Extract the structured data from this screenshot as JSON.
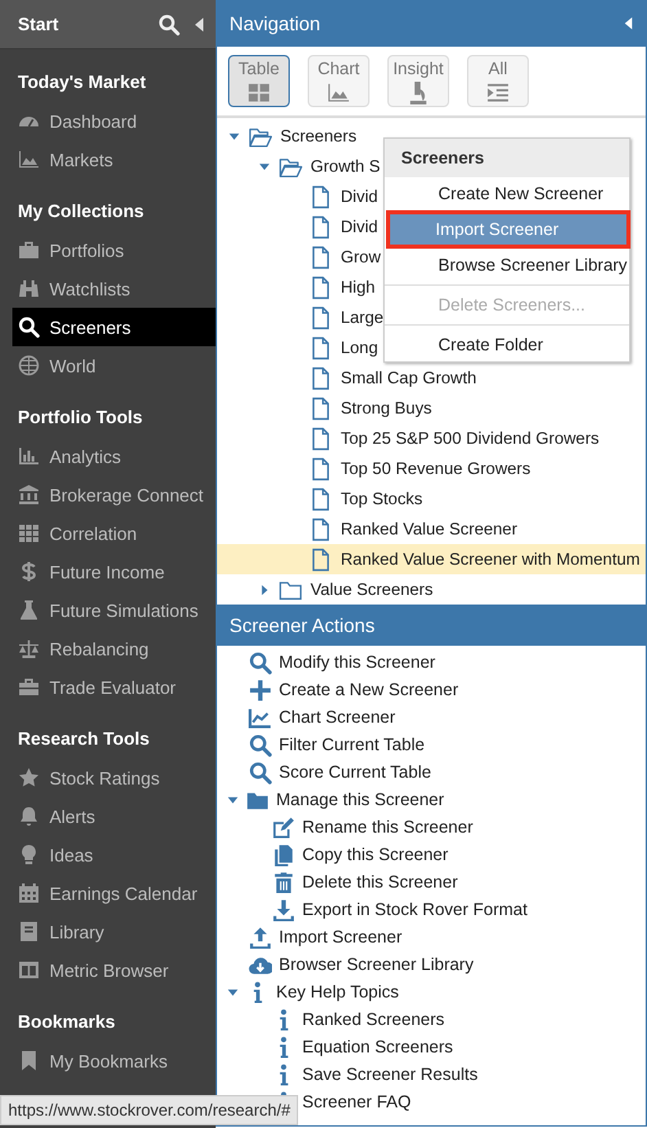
{
  "sidebar": {
    "title": "Start",
    "sections": [
      {
        "heading": "Today's Market",
        "items": [
          {
            "label": "Dashboard",
            "selected": false
          },
          {
            "label": "Markets",
            "selected": false
          }
        ]
      },
      {
        "heading": "My Collections",
        "items": [
          {
            "label": "Portfolios",
            "selected": false
          },
          {
            "label": "Watchlists",
            "selected": false
          },
          {
            "label": "Screeners",
            "selected": true
          },
          {
            "label": "World",
            "selected": false
          }
        ]
      },
      {
        "heading": "Portfolio Tools",
        "items": [
          {
            "label": "Analytics",
            "selected": false
          },
          {
            "label": "Brokerage Connect",
            "selected": false
          },
          {
            "label": "Correlation",
            "selected": false
          },
          {
            "label": "Future Income",
            "selected": false
          },
          {
            "label": "Future Simulations",
            "selected": false
          },
          {
            "label": "Rebalancing",
            "selected": false
          },
          {
            "label": "Trade Evaluator",
            "selected": false
          }
        ]
      },
      {
        "heading": "Research Tools",
        "items": [
          {
            "label": "Stock Ratings",
            "selected": false
          },
          {
            "label": "Alerts",
            "selected": false
          },
          {
            "label": "Ideas",
            "selected": false
          },
          {
            "label": "Earnings Calendar",
            "selected": false
          },
          {
            "label": "Library",
            "selected": false
          },
          {
            "label": "Metric Browser",
            "selected": false
          }
        ]
      },
      {
        "heading": "Bookmarks",
        "items": [
          {
            "label": "My Bookmarks",
            "selected": false
          }
        ]
      }
    ]
  },
  "navigation": {
    "title": "Navigation",
    "views": [
      {
        "label": "Table",
        "selected": true
      },
      {
        "label": "Chart",
        "selected": false
      },
      {
        "label": "Insight",
        "selected": false
      },
      {
        "label": "All",
        "selected": false
      }
    ],
    "tree": [
      {
        "label": "Screeners",
        "expanded": true,
        "selected": false,
        "children": [
          {
            "label": "Growth S",
            "expanded": true,
            "selected": false,
            "children": [
              {
                "label": "Divid",
                "selected": false
              },
              {
                "label": "Divid",
                "selected": false
              },
              {
                "label": "Grow",
                "selected": false
              },
              {
                "label": "High",
                "selected": false
              },
              {
                "label": "Large",
                "selected": false
              },
              {
                "label": "Long",
                "selected": false
              },
              {
                "label": "Small Cap Growth",
                "selected": false
              },
              {
                "label": "Strong Buys",
                "selected": false
              },
              {
                "label": "Top 25 S&P 500 Dividend Growers",
                "selected": false
              },
              {
                "label": "Top 50 Revenue Growers",
                "selected": false
              },
              {
                "label": "Top Stocks",
                "selected": false
              },
              {
                "label": "Ranked Value Screener",
                "selected": false
              },
              {
                "label": "Ranked Value Screener with Momentum",
                "selected": true
              }
            ]
          },
          {
            "label": "Value Screeners",
            "expanded": false,
            "selected": false
          }
        ]
      }
    ]
  },
  "context_menu": {
    "title": "Screeners",
    "groups": [
      [
        {
          "label": "Create New Screener",
          "disabled": false,
          "selected": false
        },
        {
          "label": "Import Screener",
          "disabled": false,
          "selected": true
        },
        {
          "label": "Browse Screener Library",
          "disabled": false,
          "selected": false
        }
      ],
      [
        {
          "label": "Delete Screeners...",
          "disabled": true,
          "selected": false
        }
      ],
      [
        {
          "label": "Create Folder",
          "disabled": false,
          "selected": false
        }
      ]
    ]
  },
  "screener_actions": {
    "title": "Screener Actions",
    "items": [
      {
        "label": "Modify this Screener"
      },
      {
        "label": "Create a New Screener"
      },
      {
        "label": "Chart Screener"
      },
      {
        "label": "Filter Current Table"
      },
      {
        "label": "Score Current Table"
      },
      {
        "label": "Manage this Screener",
        "expanded": true,
        "children": [
          {
            "label": "Rename this Screener"
          },
          {
            "label": "Copy this Screener"
          },
          {
            "label": "Delete this Screener"
          },
          {
            "label": "Export in Stock Rover Format"
          }
        ]
      },
      {
        "label": "Import Screener"
      },
      {
        "label": "Browser Screener Library"
      },
      {
        "label": "Key Help Topics",
        "expanded": true,
        "children": [
          {
            "label": "Ranked Screeners"
          },
          {
            "label": "Equation Screeners"
          },
          {
            "label": "Save Screener Results"
          },
          {
            "label": "Screener FAQ"
          }
        ]
      }
    ]
  },
  "status_bar": {
    "url": "https://www.stockrover.com/research/#"
  }
}
